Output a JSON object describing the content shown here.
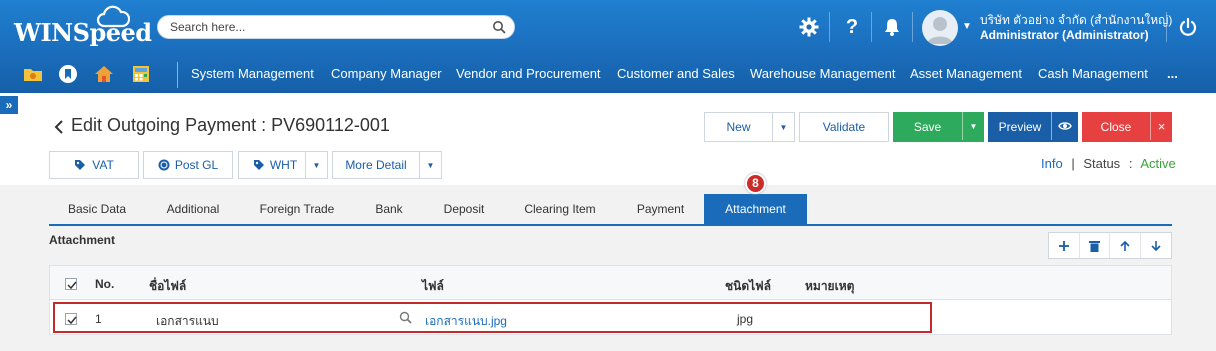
{
  "header": {
    "logo": "WINSpeed",
    "search_placeholder": "Search here...",
    "user_company": "บริษัท ตัวอย่าง จำกัด (สำนักงานใหญ่)",
    "user_role": "Administrator (Administrator)"
  },
  "nav": {
    "quick_icons": [
      "folder-icon",
      "bookmark-icon",
      "home-icon",
      "calculator-icon"
    ],
    "items": [
      "System Management",
      "Company Manager",
      "Vendor and Procurement",
      "Customer and Sales",
      "Warehouse Management",
      "Asset Management",
      "Cash Management",
      "..."
    ]
  },
  "page": {
    "title": "Edit Outgoing Payment : PV690112-001",
    "buttons": {
      "new": "New",
      "validate": "Validate",
      "save": "Save",
      "preview": "Preview",
      "close": "Close"
    },
    "action_buttons": {
      "vat": "VAT",
      "post_gl": "Post GL",
      "wht": "WHT",
      "more_detail": "More Detail"
    },
    "status": {
      "info": "Info",
      "separator": "|",
      "label": "Status",
      "colon": ":",
      "value": "Active"
    }
  },
  "tabs": [
    "Basic Data",
    "Additional",
    "Foreign Trade",
    "Bank",
    "Deposit",
    "Clearing Item",
    "Payment",
    "Attachment"
  ],
  "active_tab": "Attachment",
  "step_badge": "8",
  "attachment": {
    "section_title": "Attachment",
    "columns": {
      "no": "No.",
      "file_name": "ชื่อไฟล์",
      "file": "ไฟล์",
      "file_type": "ชนิดไฟล์",
      "remark": "หมายเหตุ"
    },
    "rows": [
      {
        "no": "1",
        "file_name": "เอกสารแนบ",
        "file": "เอกสารแนบ.jpg",
        "file_type": "jpg",
        "remark": ""
      }
    ]
  },
  "colors": {
    "header_blue": "#1a6cba",
    "save_green": "#2eaa5c",
    "preview_blue": "#1a5ea8",
    "close_red": "#e64040",
    "status_active": "#3aa33a",
    "highlight_red": "#c42a2a"
  }
}
